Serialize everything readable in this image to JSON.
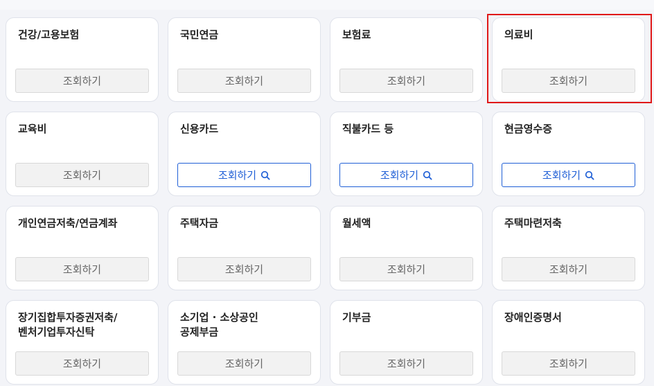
{
  "button_label": "조회하기",
  "cards": [
    {
      "title": "건강/고용보험",
      "button_state": "disabled"
    },
    {
      "title": "국민연금",
      "button_state": "disabled"
    },
    {
      "title": "보험료",
      "button_state": "disabled"
    },
    {
      "title": "의료비",
      "button_state": "disabled"
    },
    {
      "title": "교육비",
      "button_state": "disabled"
    },
    {
      "title": "신용카드",
      "button_state": "active"
    },
    {
      "title": "직불카드 등",
      "button_state": "active"
    },
    {
      "title": "현금영수증",
      "button_state": "active"
    },
    {
      "title": "개인연금저축/연금계좌",
      "button_state": "disabled"
    },
    {
      "title": "주택자금",
      "button_state": "disabled"
    },
    {
      "title": "월세액",
      "button_state": "disabled"
    },
    {
      "title": "주택마련저축",
      "button_state": "disabled"
    },
    {
      "title": "장기집합투자증권저축/\n벤처기업투자신탁",
      "button_state": "disabled"
    },
    {
      "title": "소기업 · 소상공인\n공제부금",
      "button_state": "disabled"
    },
    {
      "title": "기부금",
      "button_state": "disabled"
    },
    {
      "title": "장애인증명서",
      "button_state": "disabled"
    }
  ],
  "colors": {
    "active": "#1f5fd6",
    "highlight": "#e01818",
    "disabled_bg": "#f2f2f2"
  },
  "icons": {
    "active_button_icon": "search-icon"
  }
}
